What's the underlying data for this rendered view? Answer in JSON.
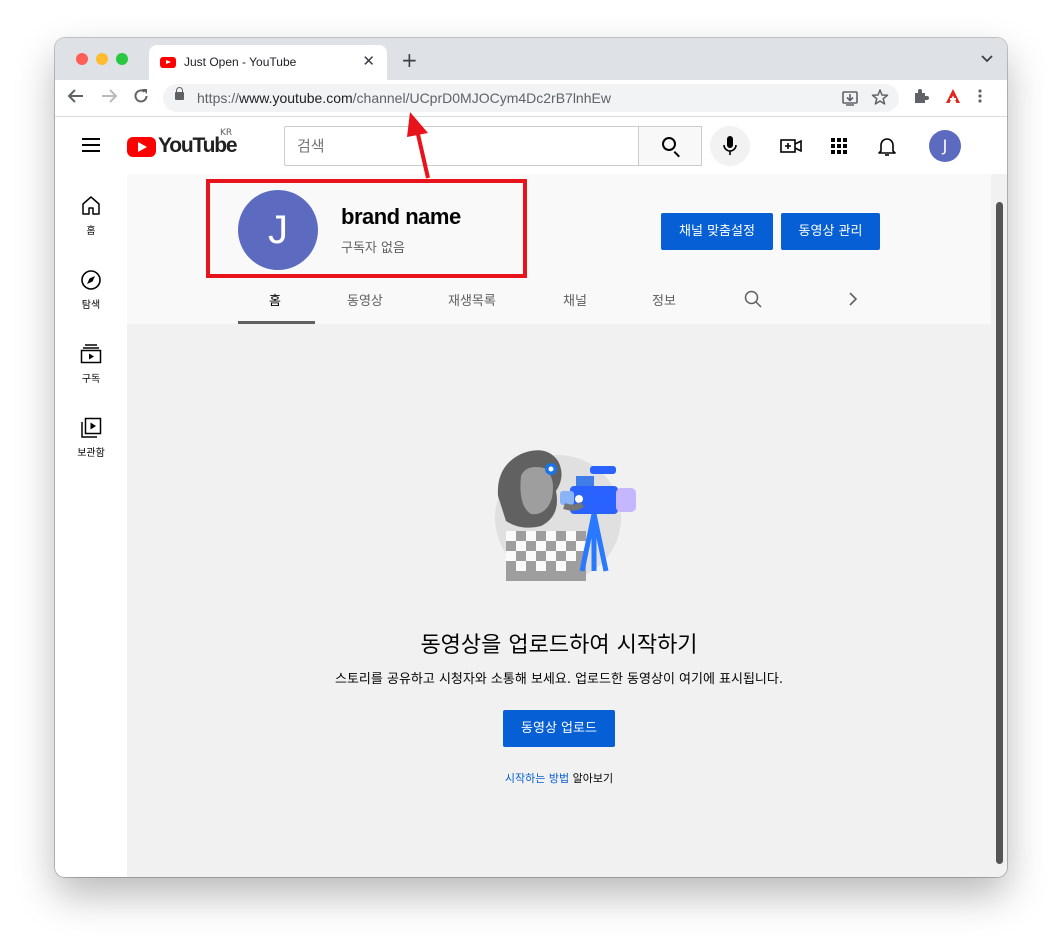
{
  "browser": {
    "tab_title": "Just Open - YouTube",
    "tab_close": "✕",
    "new_tab": "+",
    "url_prefix": "https://",
    "url_host": "www.youtube.com",
    "url_path": "/channel/UCprD0MJOCym4Dc2rB7lnhEw"
  },
  "youtube": {
    "logo_text": "YouTube",
    "country": "KR",
    "search_placeholder": "검색",
    "avatar_letter": "J"
  },
  "guide": {
    "items": [
      {
        "label": "홈",
        "icon": "home-icon"
      },
      {
        "label": "탐색",
        "icon": "explore-icon"
      },
      {
        "label": "구독",
        "icon": "subscriptions-icon"
      },
      {
        "label": "보관함",
        "icon": "library-icon"
      }
    ]
  },
  "channel": {
    "avatar_letter": "J",
    "name": "brand name",
    "subscribers": "구독자 없음",
    "customize_button": "채널 맞춤설정",
    "manage_button": "동영상 관리",
    "tabs": [
      "홈",
      "동영상",
      "재생목록",
      "채널",
      "정보"
    ],
    "active_tab": "홈"
  },
  "empty_state": {
    "title": "동영상을 업로드하여 시작하기",
    "subtitle": "스토리를 공유하고 시청자와 소통해 보세요. 업로드한 동영상이 여기에 표시됩니다.",
    "upload_button": "동영상 업로드",
    "learn_link": "시작하는 방법",
    "learn_suffix": " 알아보기"
  },
  "colors": {
    "accent": "#065fd4",
    "avatar": "#5c6bc0",
    "youtube_red": "#ff0000",
    "annotation_red": "#e8141c"
  }
}
